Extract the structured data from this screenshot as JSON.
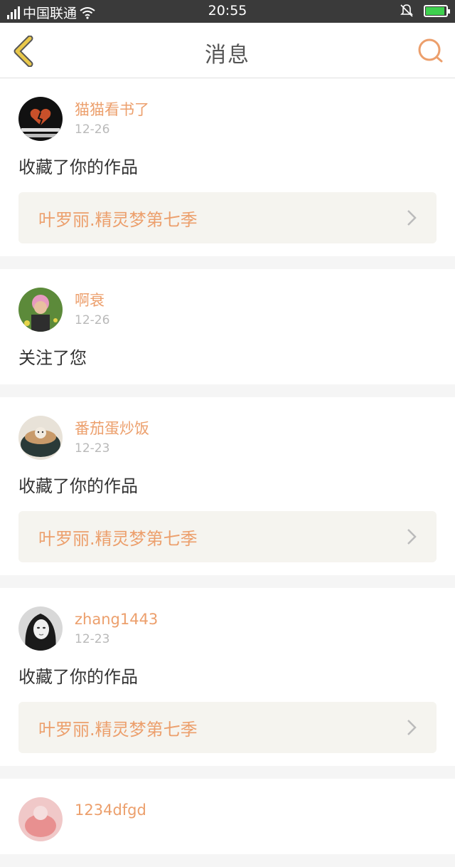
{
  "status": {
    "network": "4G",
    "carrier": "中国联通",
    "time": "20:55"
  },
  "header": {
    "title": "消息"
  },
  "colors": {
    "accent": "#ec9f6c",
    "back_icon": "#e9c84a"
  },
  "messages": [
    {
      "user": "猫猫看书了",
      "date": "12-26",
      "action": "收藏了你的作品",
      "work": "叶罗丽.精灵梦第七季"
    },
    {
      "user": "啊衰",
      "date": "12-26",
      "action": "关注了您"
    },
    {
      "user": "番茄蛋炒饭",
      "date": "12-23",
      "action": "收藏了你的作品",
      "work": "叶罗丽.精灵梦第七季"
    },
    {
      "user": "zhang1443",
      "date": "12-23",
      "action": "收藏了你的作品",
      "work": "叶罗丽.精灵梦第七季"
    },
    {
      "user": "1234dfgd"
    }
  ]
}
